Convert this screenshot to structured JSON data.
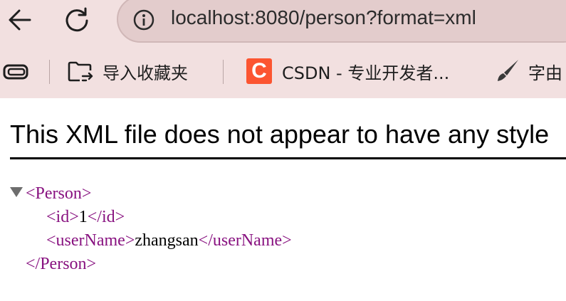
{
  "address_bar": {
    "url": "localhost:8080/person?format=xml"
  },
  "bookmarks": {
    "items": [
      {
        "label": "导入收藏夹",
        "icon": "import-favorites-icon"
      },
      {
        "label": "CSDN - 专业开发者...",
        "icon": "csdn-logo-icon",
        "logo_letter": "C"
      },
      {
        "label": "字由",
        "icon": "brush-icon"
      }
    ]
  },
  "page": {
    "notice": "This XML file does not appear to have any style",
    "xml": {
      "root_open": "<Person>",
      "id_open": "<id>",
      "id_value": "1",
      "id_close": "</id>",
      "username_open": "<userName>",
      "username_value": "zhangsan",
      "username_close": "</userName>",
      "root_close": "</Person>"
    }
  },
  "colors": {
    "chrome_background": "#f2e0e0",
    "omnibox_background": "#e3cccc",
    "xml_tag": "#881280",
    "csdn_brand": "#fc5531"
  }
}
